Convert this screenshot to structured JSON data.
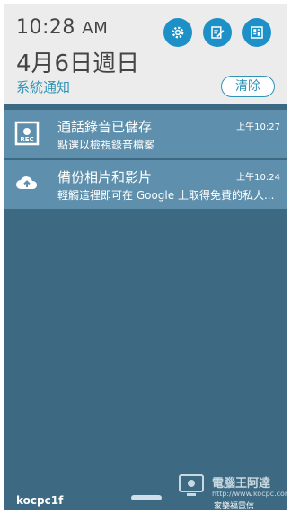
{
  "header": {
    "time": "10:28",
    "ampm": "AM",
    "date": "4月6日週日",
    "section_title": "系統通知",
    "clear_label": "清除",
    "quick_icons": [
      "settings-icon",
      "edit-icon",
      "app-list-icon"
    ]
  },
  "notifications": [
    {
      "icon": "rec-icon",
      "title": "通話錄音已儲存",
      "subtitle": "點選以檢視錄音檔案",
      "time": "上午10:27"
    },
    {
      "icon": "cloud-upload-icon",
      "title": "備份相片和影片",
      "subtitle": "輕觸這裡即可在 Google 上取得免費的私人...",
      "time": "上午10:24"
    }
  ],
  "footer": {
    "carrier": "kocpc1f",
    "telecom": "家樂福電信",
    "watermark": "電腦王阿達",
    "watermark_url": "http://www.kocpc.com.tw"
  },
  "colors": {
    "accent": "#1e90c8",
    "notification_bg": "#5e90ad",
    "panel_bg": "#3d6a82",
    "header_bg": "#ececec"
  }
}
